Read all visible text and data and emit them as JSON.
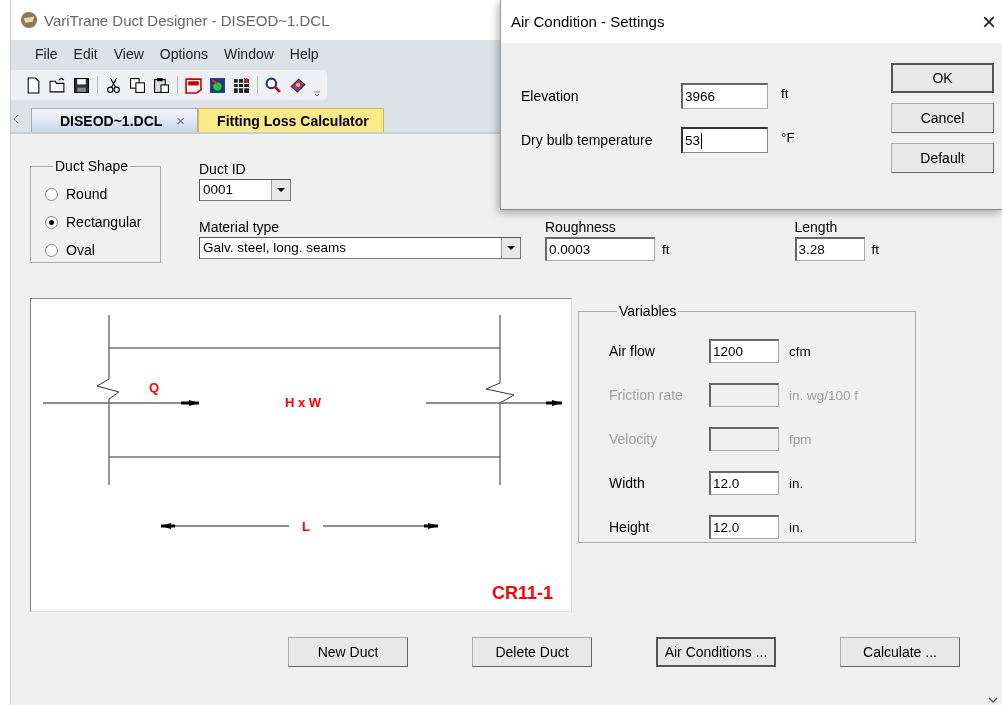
{
  "window": {
    "title": "VariTrane Duct Designer - DISEOD~1.DCL"
  },
  "menu": [
    "File",
    "Edit",
    "View",
    "Options",
    "Window",
    "Help"
  ],
  "tabs": [
    {
      "label": "DISEOD~1.DCL",
      "selected": false,
      "closable": true,
      "close": "×"
    },
    {
      "label": "Fitting Loss Calculator",
      "selected": true,
      "closable": false
    }
  ],
  "duct_shape": {
    "title": "Duct Shape",
    "options": [
      {
        "label": "Round",
        "selected": false
      },
      {
        "label": "Rectangular",
        "selected": true
      },
      {
        "label": "Oval",
        "selected": false
      }
    ]
  },
  "duct_id": {
    "label": "Duct ID",
    "value": "0001"
  },
  "material": {
    "label": "Material type",
    "value": "Galv. steel, long. seams"
  },
  "roughness": {
    "label": "Roughness",
    "value": "0.0003",
    "unit": "ft"
  },
  "length": {
    "label": "Length",
    "value": "3.28",
    "unit": "ft"
  },
  "diagram": {
    "flow": "Q",
    "size": "H x W",
    "length": "L",
    "code": "CR11-1"
  },
  "variables": {
    "title": "Variables",
    "rows": [
      {
        "label": "Air flow",
        "value": "1200",
        "unit": "cfm",
        "disabled": false
      },
      {
        "label": "Friction rate",
        "unit": "in. wg/100 f",
        "disabled": true
      },
      {
        "label": "Velocity",
        "unit": "fpm",
        "disabled": true
      },
      {
        "label": "Width",
        "value": "12.0",
        "unit": "in.",
        "disabled": false
      },
      {
        "label": "Height",
        "value": "12.0",
        "unit": "in.",
        "disabled": false
      }
    ]
  },
  "buttons": [
    {
      "label": "New Duct",
      "focused": false
    },
    {
      "label": "Delete Duct",
      "focused": false
    },
    {
      "label": "Air Conditions ...",
      "focused": true
    },
    {
      "label": "Calculate ...",
      "focused": false
    }
  ],
  "dialog": {
    "title": "Air Condition - Settings",
    "close": "×",
    "fields": [
      {
        "label": "Elevation",
        "value": "3966",
        "unit": "ft",
        "focused": false
      },
      {
        "label": "Dry bulb temperature",
        "value": "53",
        "unit": "°F",
        "focused": true
      }
    ],
    "buttons": [
      {
        "label": "OK",
        "default": true
      },
      {
        "label": "Cancel",
        "default": false
      },
      {
        "label": "Default",
        "default": false
      }
    ]
  }
}
